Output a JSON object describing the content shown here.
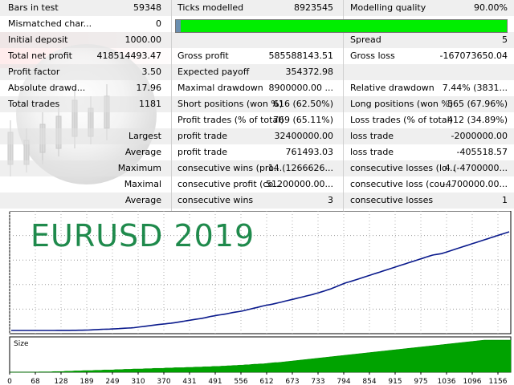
{
  "rows": [
    {
      "c0_label": "Bars in test",
      "c0_value": "59348",
      "c1_label": "Ticks modelled",
      "c1_value": "8923545",
      "c2_label": "Modelling quality",
      "c2_value": "90.00%"
    },
    {
      "c0_label": "Mismatched char...",
      "c0_value": "0"
    },
    {
      "c0_label": "Initial deposit",
      "c0_value": "1000.00",
      "c2_label": "Spread",
      "c2_value": "5"
    },
    {
      "c0_label": "Total net profit",
      "c0_value": "418514493.47",
      "c1_label": "Gross profit",
      "c1_value": "585588143.51",
      "c2_label": "Gross loss",
      "c2_value": "-167073650.04"
    },
    {
      "c0_label": "Profit factor",
      "c0_value": "3.50",
      "c1_label": "Expected payoff",
      "c1_value": "354372.98"
    },
    {
      "c0_label": "Absolute drawd...",
      "c0_value": "17.96",
      "c1_label": "Maximal drawdown",
      "c1_value": "8900000.00 ...",
      "c2_label": "Relative drawdown",
      "c2_value": "7.44% (3831..."
    },
    {
      "c0_label": "Total trades",
      "c0_value": "1181",
      "c1_label": "Short positions (won %)",
      "c1_value": "616 (62.50%)",
      "c2_label": "Long positions (won %)",
      "c2_value": "565 (67.96%)"
    },
    {
      "c1_label": "Profit trades (% of total)",
      "c1_value": "769 (65.11%)",
      "c2_label": "Loss trades (% of total)",
      "c2_value": "412 (34.89%)"
    },
    {
      "c0_right": "Largest",
      "c1_label": "profit trade",
      "c1_value": "32400000.00",
      "c2_label": "loss trade",
      "c2_value": "-2000000.00"
    },
    {
      "c0_right": "Average",
      "c1_label": "profit trade",
      "c1_value": "761493.03",
      "c2_label": "loss trade",
      "c2_value": "-405518.57"
    },
    {
      "c0_right": "Maximum",
      "c1_label": "consecutive wins (pro...",
      "c1_value": "14 (1266626...",
      "c2_label": "consecutive losses (lo...",
      "c2_value": "4 (-4700000..."
    },
    {
      "c0_right": "Maximal",
      "c1_label": "consecutive profit (co...",
      "c1_value": "51200000.00...",
      "c2_label": "consecutive loss (cou...",
      "c2_value": "-4700000.00..."
    },
    {
      "c0_right": "Average",
      "c1_label": "consecutive wins",
      "c1_value": "3",
      "c2_label": "consecutive losses",
      "c2_value": "1"
    }
  ],
  "quality_bar": {
    "percent": 90,
    "color": "#00ee00"
  },
  "chart_title": "EURUSD 2019",
  "size_label": "Size",
  "chart_data": {
    "type": "line",
    "x_ticks": [
      "0",
      "68",
      "128",
      "189",
      "249",
      "310",
      "370",
      "431",
      "491",
      "556",
      "612",
      "673",
      "733",
      "794",
      "854",
      "915",
      "975",
      "1036",
      "1096",
      "1156"
    ],
    "series": [
      {
        "values": [
          0,
          0,
          0,
          0,
          0,
          0,
          0,
          0,
          0,
          0,
          0,
          1,
          2,
          4,
          7,
          10,
          12,
          15,
          20,
          23,
          30,
          36,
          44,
          55,
          65,
          80,
          110,
          150,
          185,
          210,
          235,
          260,
          280,
          305,
          345,
          380,
          420,
          450,
          480,
          520,
          570,
          640,
          720,
          800,
          880,
          960,
          1040,
          1120,
          1200,
          1270,
          1330,
          1400,
          1470,
          1560,
          1650,
          1750,
          1850,
          1960,
          2050,
          2150,
          2250,
          2350,
          2450,
          2550,
          2700,
          2850,
          2950,
          3050,
          3150,
          3250,
          3350,
          3480,
          3600,
          3700,
          3800,
          3900,
          4050,
          4200,
          4350,
          4500,
          4650,
          4800,
          4950,
          5100,
          5200,
          5300,
          5450,
          5600,
          5750,
          5900,
          6050,
          6200,
          6350,
          6500,
          6650,
          6800,
          6950,
          7100,
          7250,
          7450,
          7600,
          7800,
          8000,
          8200,
          8400,
          8650,
          8900,
          9150,
          9400,
          9650,
          9800,
          10000,
          10200,
          10400,
          10600,
          10800,
          11000,
          11200,
          11400,
          11600,
          11800,
          12000,
          12200,
          12400,
          12600,
          12800,
          13000,
          13200,
          13400,
          13600,
          13800,
          14000,
          14200,
          14400,
          14600,
          14800,
          15000,
          15200,
          15300,
          15400,
          15500,
          15700,
          15900,
          16100,
          16300,
          16500,
          16700,
          16900,
          17100,
          17300,
          17500,
          17700,
          17900,
          18100,
          18300,
          18500,
          18700,
          18900,
          19100,
          19300,
          19500,
          19700,
          19900
        ]
      },
      {
        "name": "Size",
        "values": [
          0,
          0,
          0,
          0,
          0,
          0,
          0,
          0,
          0,
          0,
          1,
          1,
          1,
          1,
          1,
          2,
          2,
          2,
          2,
          3,
          3,
          3,
          4,
          4,
          4,
          5,
          5,
          5,
          5,
          6,
          6,
          6,
          7,
          7,
          7,
          7,
          8,
          8,
          8,
          9,
          9,
          9,
          10,
          10,
          10,
          10,
          11,
          11,
          11,
          12,
          12,
          12,
          12,
          13,
          13,
          13,
          14,
          14,
          14,
          14,
          15,
          15,
          15,
          16,
          16,
          16,
          17,
          17,
          17,
          18,
          18,
          18,
          19,
          19,
          20,
          20,
          21,
          21,
          22,
          22,
          23,
          23,
          24,
          25,
          25,
          26,
          26,
          27,
          28,
          29,
          30,
          30,
          31,
          32,
          33,
          34,
          35,
          36,
          37,
          38,
          39,
          40,
          41,
          42,
          43,
          44,
          45,
          46,
          47,
          48,
          49,
          50,
          51,
          52,
          53,
          54,
          55,
          56,
          57,
          58,
          59,
          60,
          61,
          62,
          63,
          64,
          65,
          66,
          67,
          68,
          69,
          70,
          71,
          72,
          73,
          74,
          75,
          76,
          77,
          78,
          79,
          80,
          81,
          82,
          83,
          84,
          85,
          86,
          87,
          88,
          89,
          90,
          91,
          92,
          93,
          94,
          95,
          96,
          97,
          98,
          99,
          100,
          100,
          100,
          100,
          100,
          100,
          100,
          100,
          100,
          100
        ]
      }
    ]
  }
}
